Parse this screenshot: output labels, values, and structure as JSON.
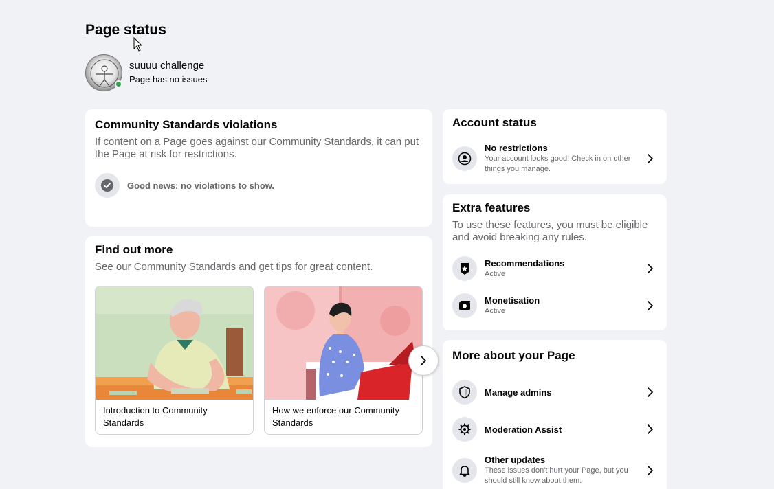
{
  "page_title": "Page status",
  "page": {
    "name": "suuuu challenge",
    "status": "Page has no issues",
    "avatar_text": "SUUUU CHALLEN"
  },
  "violations": {
    "title": "Community Standards violations",
    "description": "If content on a Page goes against our Community Standards, it can put the Page at risk for restrictions.",
    "good_news": "Good news: no violations to show."
  },
  "find_out_more": {
    "title": "Find out more",
    "description": "See our Community Standards and get tips for great content.",
    "tiles": [
      {
        "label": "Introduction to Community Standards"
      },
      {
        "label": "How we enforce our Community Standards"
      }
    ]
  },
  "account_status": {
    "title": "Account status",
    "item": {
      "title": "No restrictions",
      "subtitle": "Your account looks good! Check in on other things you manage."
    }
  },
  "extra_features": {
    "title": "Extra features",
    "description": "To use these features, you must be eligible and avoid breaking any rules.",
    "items": [
      {
        "title": "Recommendations",
        "subtitle": "Active"
      },
      {
        "title": "Monetisation",
        "subtitle": "Active"
      }
    ]
  },
  "more_about": {
    "title": "More about your Page",
    "items": [
      {
        "title": "Manage admins"
      },
      {
        "title": "Moderation Assist"
      },
      {
        "title": "Other updates",
        "subtitle": "These issues don't hurt your Page, but you should still know about them."
      }
    ]
  },
  "colors": {
    "background": "#f0f2f5",
    "card": "#ffffff",
    "secondary_text": "#65676b",
    "online_green": "#31a24c"
  }
}
